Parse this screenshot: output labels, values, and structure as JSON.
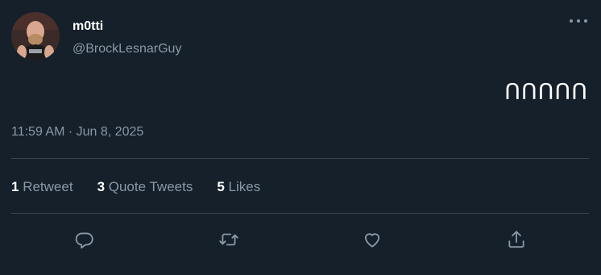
{
  "user": {
    "display_name": "m0tti",
    "handle": "@BrockLesnarGuy"
  },
  "tweet": {
    "text": "ՈՈՈՈՈ",
    "timestamp": "11:59 AM · Jun 8, 2025"
  },
  "stats": {
    "retweets_count": "1",
    "retweets_label": "Retweet",
    "quotes_count": "3",
    "quotes_label": "Quote Tweets",
    "likes_count": "5",
    "likes_label": "Likes"
  },
  "icons": {
    "reply": "reply-icon",
    "retweet": "retweet-icon",
    "like": "heart-icon",
    "share": "share-icon",
    "more": "more-icon"
  },
  "colors": {
    "background": "#15202b",
    "secondary_text": "#8b98a5",
    "divider": "#38444d"
  }
}
